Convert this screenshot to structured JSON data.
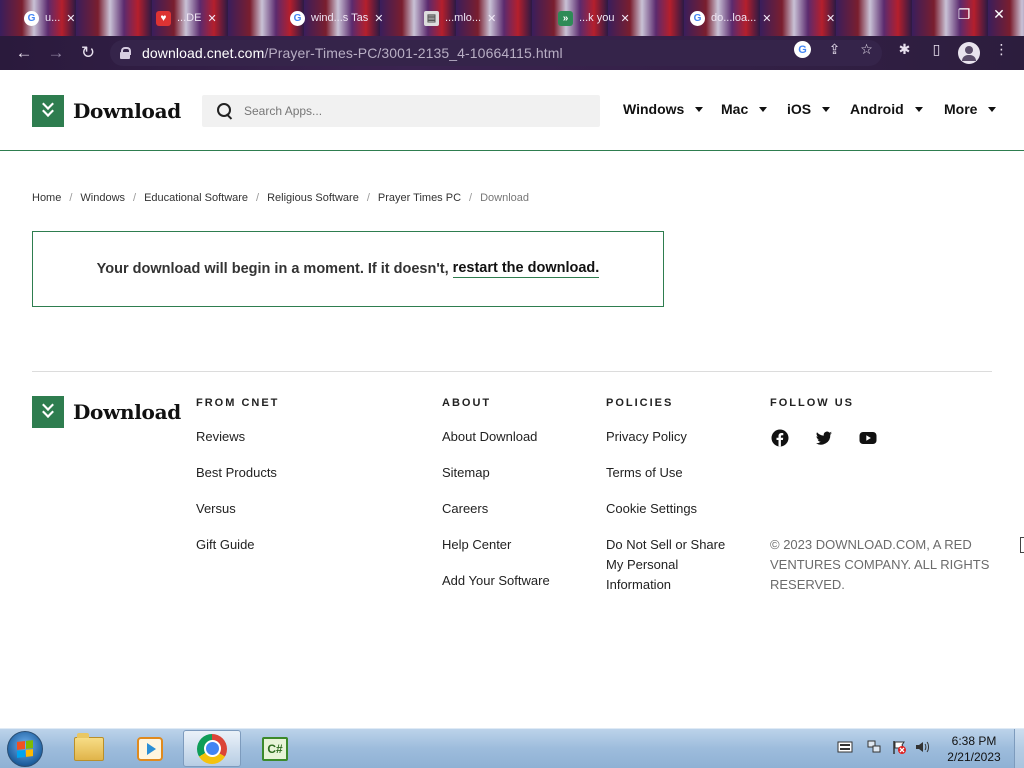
{
  "browser": {
    "tabs": [
      {
        "title": "u...",
        "favicon": "google-icon"
      },
      {
        "title": "...DE",
        "favicon": "heart-icon"
      },
      {
        "title": "wind...s Tas",
        "favicon": "google-icon"
      },
      {
        "title": "...mlo...",
        "favicon": "page-icon"
      },
      {
        "title": "...k you",
        "favicon": "download-icon"
      },
      {
        "title": "do...loa...",
        "favicon": "google-icon"
      }
    ],
    "url_host": "download.cnet.com",
    "url_path": "/Prayer-Times-PC/3001-2135_4-10664115.html"
  },
  "site": {
    "logo_text": "Download",
    "search_placeholder": "Search Apps...",
    "nav": [
      "Windows",
      "Mac",
      "iOS",
      "Android",
      "More"
    ]
  },
  "breadcrumb": [
    "Home",
    "Windows",
    "Educational Software",
    "Religious Software",
    "Prayer Times PC",
    "Download"
  ],
  "notice": {
    "text": "Your download will begin in a moment. If it doesn't,",
    "link": "restart the download."
  },
  "footer": {
    "logo_text": "Download",
    "columns": [
      {
        "heading": "FROM CNET",
        "links": [
          "Reviews",
          "Best Products",
          "Versus",
          "Gift Guide"
        ]
      },
      {
        "heading": "ABOUT",
        "links": [
          "About Download",
          "Sitemap",
          "Careers",
          "Help Center",
          "Add Your Software"
        ]
      },
      {
        "heading": "POLICIES",
        "links": [
          "Privacy Policy",
          "Terms of Use",
          "Cookie Settings",
          "Do Not Sell or Share My Personal Information"
        ]
      },
      {
        "heading": "FOLLOW US",
        "links": []
      }
    ],
    "social": [
      "facebook-icon",
      "twitter-icon",
      "youtube-icon"
    ],
    "copyright": "© 2023 DOWNLOAD.COM, A RED VENTURES COMPANY. ALL RIGHTS RESERVED."
  },
  "taskbar": {
    "time": "6:38 PM",
    "date": "2/21/2023",
    "vs_label": "C#"
  },
  "colors": {
    "brand_green": "#2e7d4f"
  }
}
